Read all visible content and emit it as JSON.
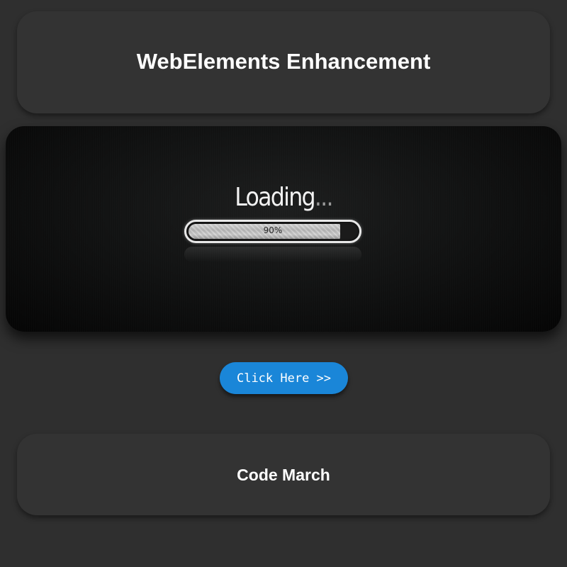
{
  "header": {
    "title": "WebElements Enhancement"
  },
  "banner": {
    "loading_text": "Loading",
    "loading_dots": "...",
    "progress_label": "90%",
    "progress_value": 0.9
  },
  "cta": {
    "label": "Click Here >>"
  },
  "footer": {
    "title": "Code March"
  },
  "colors": {
    "page_background": "#2f2f2f",
    "card_background": "#333333",
    "button_background": "#1a86d8",
    "text": "#ffffff"
  }
}
